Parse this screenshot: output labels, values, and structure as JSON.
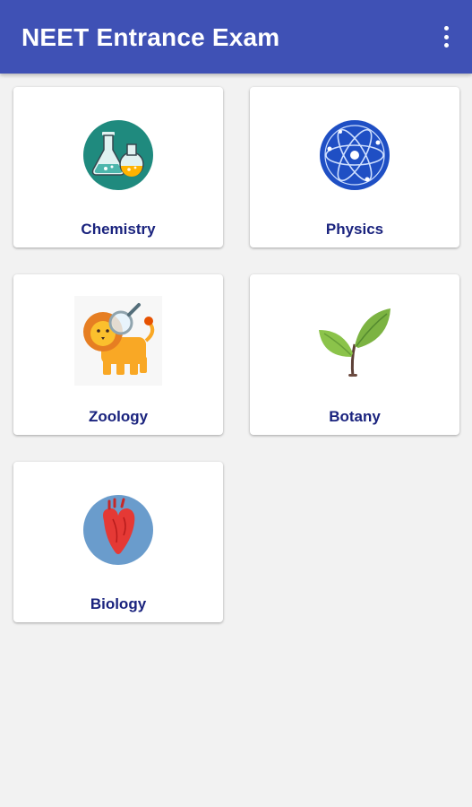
{
  "appbar": {
    "title": "NEET Entrance Exam",
    "color": "#3f51b5"
  },
  "subjects": [
    {
      "label": "Chemistry",
      "icon": "flask-icon"
    },
    {
      "label": "Physics",
      "icon": "atom-icon"
    },
    {
      "label": "Zoology",
      "icon": "lion-icon"
    },
    {
      "label": "Botany",
      "icon": "plant-icon"
    },
    {
      "label": "Biology",
      "icon": "heart-icon"
    }
  ],
  "colors": {
    "label_text": "#1a237e",
    "background": "#f2f2f2"
  }
}
